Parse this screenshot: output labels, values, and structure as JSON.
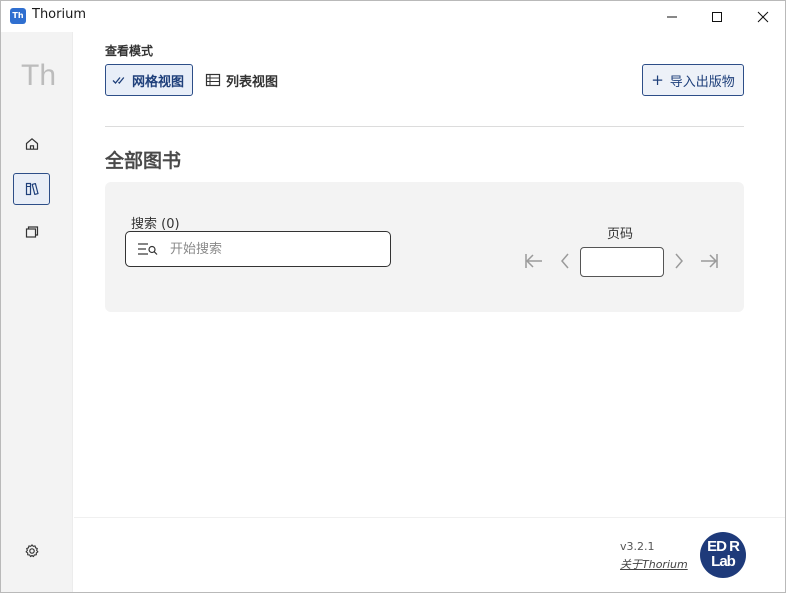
{
  "window": {
    "app_icon_text": "Th",
    "title": "Thorium",
    "controls": {
      "minimize": "minimize-icon",
      "maximize": "maximize-icon",
      "close": "close-icon"
    }
  },
  "sidebar": {
    "logo": "Th",
    "items": [
      {
        "id": "home",
        "icon": "home-icon",
        "active": false
      },
      {
        "id": "library",
        "icon": "books-icon",
        "active": true
      },
      {
        "id": "catalogs",
        "icon": "catalog-icon",
        "active": false
      },
      {
        "id": "settings",
        "icon": "gear-icon",
        "active": false
      }
    ]
  },
  "main": {
    "view_mode_label": "查看模式",
    "view_grid_label": "网格视图",
    "view_list_label": "列表视图",
    "import_label": "导入出版物",
    "page_title": "全部图书",
    "search": {
      "label": "搜索 (0)",
      "placeholder": "开始搜索",
      "value": ""
    },
    "pagination": {
      "label": "页码",
      "value": ""
    }
  },
  "footer": {
    "version": "v3.2.1",
    "about_link": "关于Thorium",
    "brand_logo_text": [
      "ED R",
      "Lab"
    ]
  },
  "colors": {
    "accent": "#2d4e88",
    "accent_bg": "#e8eef8",
    "sidebar_bg": "#f3f3f3",
    "panel_bg": "#f3f3f3"
  }
}
